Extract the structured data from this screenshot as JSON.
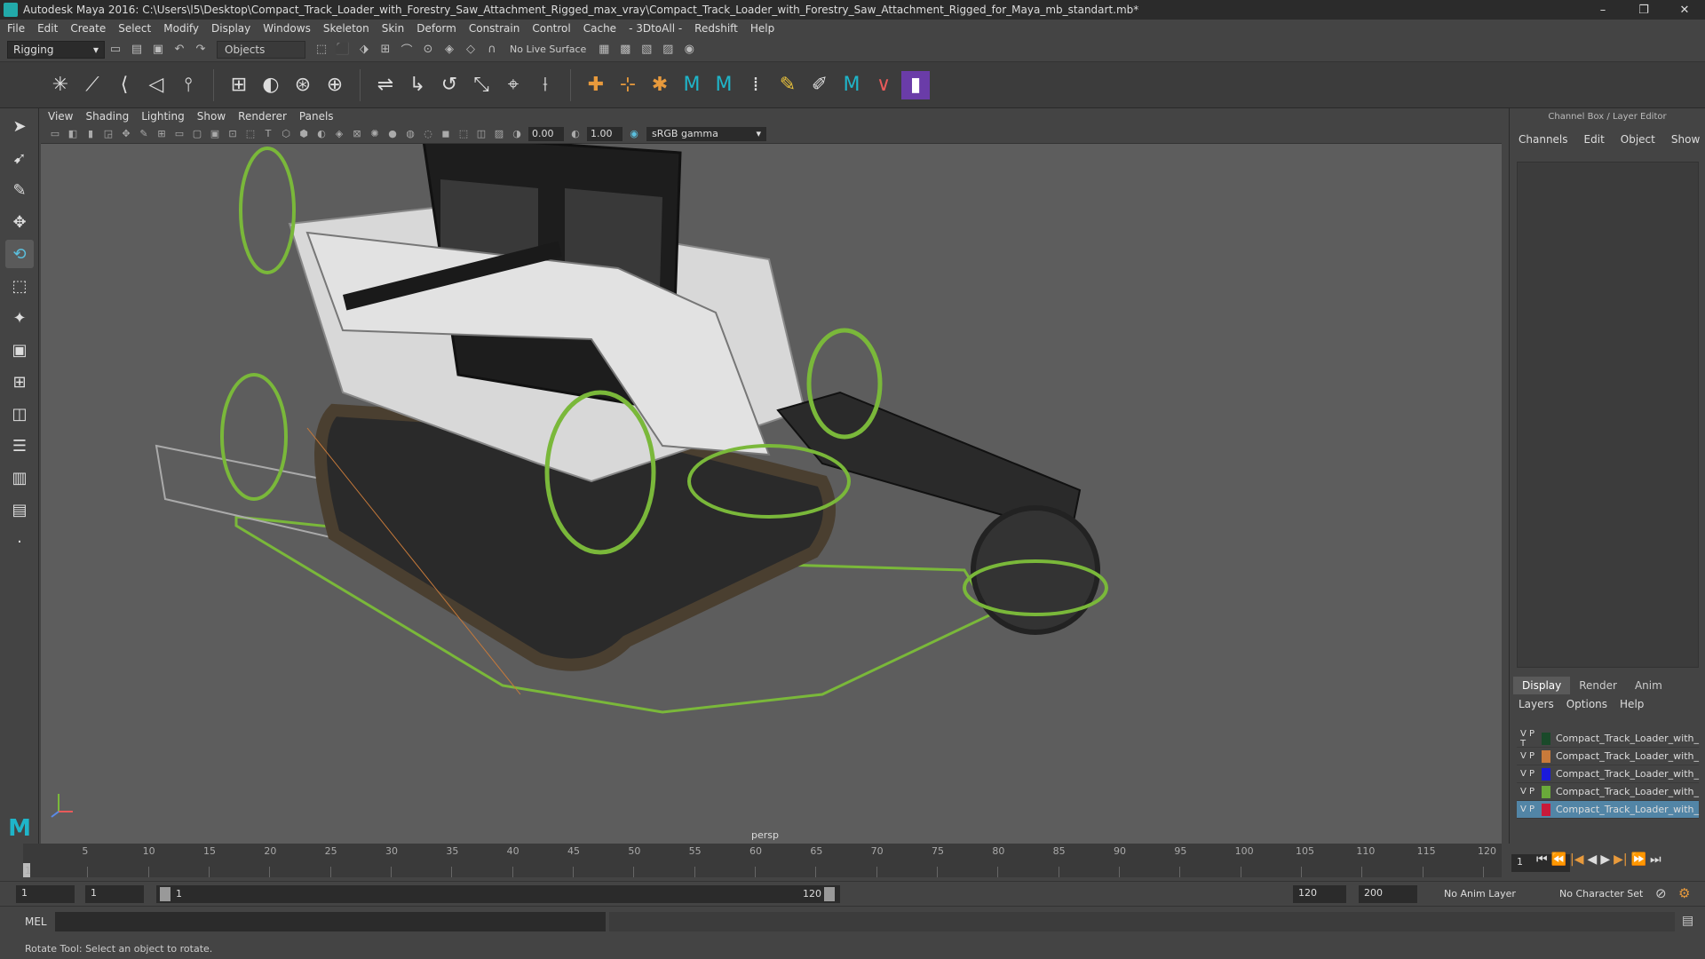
{
  "window": {
    "title": "Autodesk Maya 2016: C:\\Users\\l5\\Desktop\\Compact_Track_Loader_with_Forestry_Saw_Attachment_Rigged_max_vray\\Compact_Track_Loader_with_Forestry_Saw_Attachment_Rigged_for_Maya_mb_standart.mb*",
    "minimize": "–",
    "maximize": "❐",
    "close": "✕"
  },
  "menu": [
    "File",
    "Edit",
    "Create",
    "Select",
    "Modify",
    "Display",
    "Windows",
    "Skeleton",
    "Skin",
    "Deform",
    "Constrain",
    "Control",
    "Cache",
    "- 3DtoAll -",
    "Redshift",
    "Help"
  ],
  "status_line": {
    "mode": "Rigging",
    "objects": "Objects",
    "live_surface": "No Live Surface"
  },
  "viewport": {
    "menu": [
      "View",
      "Shading",
      "Lighting",
      "Show",
      "Renderer",
      "Panels"
    ],
    "field_a": "0.00",
    "field_b": "1.00",
    "color_space": "sRGB gamma",
    "camera_label": "persp"
  },
  "channel_box": {
    "header": "Channel Box / Layer Editor",
    "menu": [
      "Channels",
      "Edit",
      "Object",
      "Show"
    ],
    "tabs": [
      "Display",
      "Render",
      "Anim"
    ],
    "layer_menu": [
      "Layers",
      "Options",
      "Help"
    ],
    "layers": [
      {
        "flags": "V P T",
        "name": "Compact_Track_Loader_with_",
        "color": "#1a4a2a"
      },
      {
        "flags": "V P",
        "name": "Compact_Track_Loader_with_",
        "color": "#c87a3a"
      },
      {
        "flags": "V P",
        "name": "Compact_Track_Loader_with_",
        "color": "#1a1adc"
      },
      {
        "flags": "V P",
        "name": "Compact_Track_Loader_with_",
        "color": "#6aaa3a"
      },
      {
        "flags": "V P",
        "name": "Compact_Track_Loader_with_",
        "color": "#c81a3a"
      }
    ]
  },
  "timeline": {
    "ticks": [
      "5",
      "10",
      "15",
      "20",
      "25",
      "30",
      "35",
      "40",
      "45",
      "50",
      "55",
      "60",
      "65",
      "70",
      "75",
      "80",
      "85",
      "90",
      "95",
      "100",
      "105",
      "110",
      "115",
      "120"
    ],
    "current_frame_marker": "1",
    "current_frame": "1"
  },
  "range": {
    "start": "1",
    "start_b": "1",
    "slider_start": "1",
    "slider_end": "120",
    "end": "120",
    "max_end": "200",
    "anim_layer": "No Anim Layer",
    "char_set": "No Character Set"
  },
  "cmd": {
    "label": "MEL"
  },
  "help_line": "Rotate Tool: Select an object to rotate."
}
